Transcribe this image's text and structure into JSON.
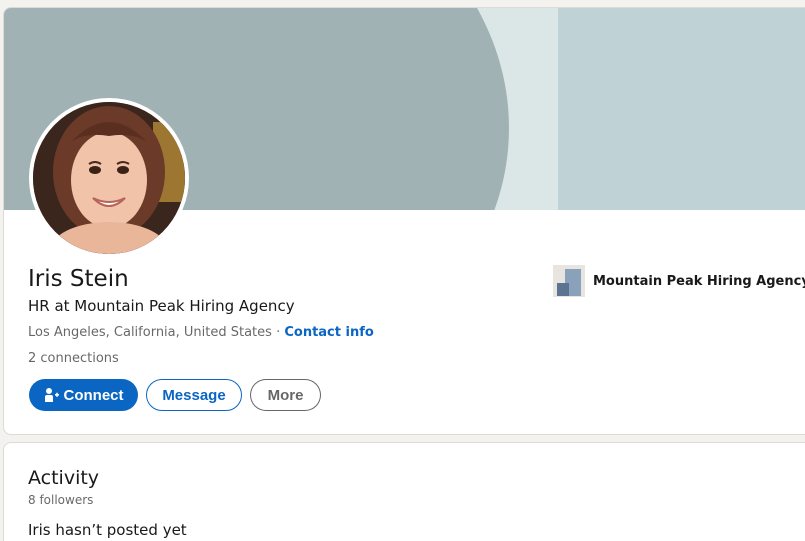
{
  "profile": {
    "name": "Iris Stein",
    "headline": "HR at Mountain Peak Hiring Agency",
    "location": "Los Angeles, California, United States",
    "separator": " · ",
    "contact_info": "Contact info",
    "connections": "2 connections",
    "company": "Mountain Peak Hiring Agency"
  },
  "actions": {
    "connect": "Connect",
    "message": "Message",
    "more": "More"
  },
  "activity": {
    "title": "Activity",
    "followers": "8 followers",
    "empty": "Iris hasn’t posted yet"
  },
  "colors": {
    "accent": "#0a66c2",
    "banner_dark": "#a1b2b5",
    "banner_light": "#dbe6e7",
    "banner_right": "#bfd2d5"
  }
}
